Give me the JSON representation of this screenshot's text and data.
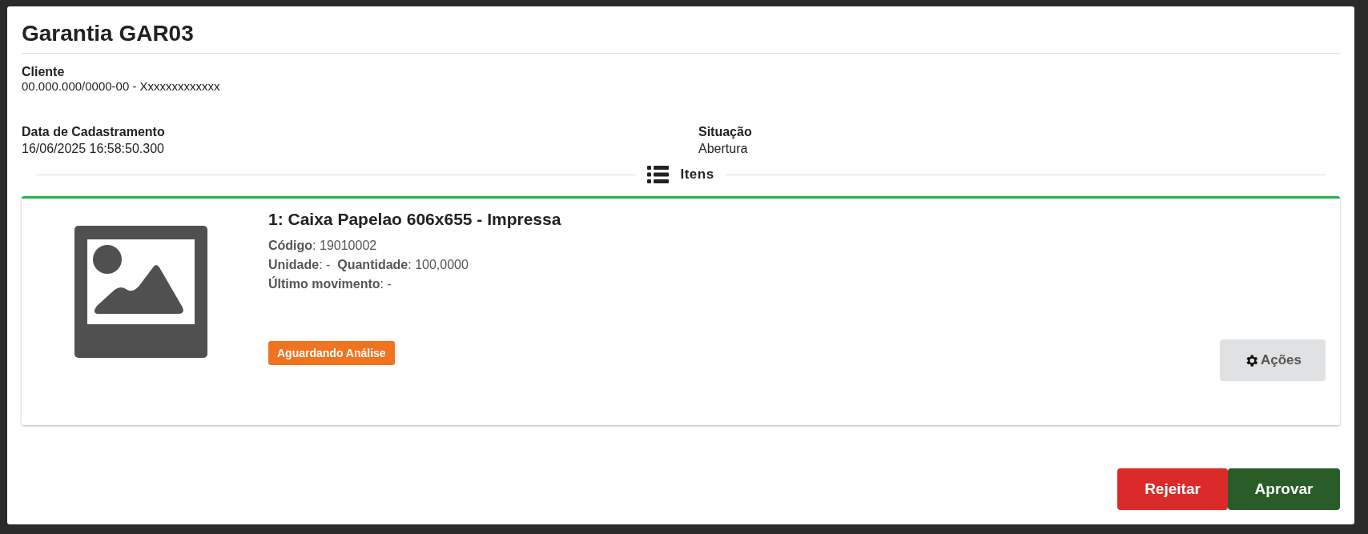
{
  "title": "Garantia GAR03",
  "client": {
    "label": "Cliente",
    "value": "00.000.000/0000-00 - Xxxxxxxxxxxxx"
  },
  "fields": [
    {
      "label": "Data de Cadastramento",
      "value": "16/06/2025 16:58:50.300"
    },
    {
      "label": "Situação",
      "value": "Abertura"
    }
  ],
  "section": {
    "label": "Itens"
  },
  "items": [
    {
      "title": "1: Caixa Papelao 606x655 - Impressa",
      "lines": [
        "**Código**: 19010002",
        "**Unidade**: -  **Quantidade**: 100,0000",
        "**Último movimento**: -"
      ],
      "status": {
        "label": "Aguardando Análise",
        "color": "#f07320"
      },
      "action": {
        "label": "Ações"
      }
    }
  ],
  "buttons": [
    {
      "label": "Rejeitar",
      "kind": "danger"
    },
    {
      "label": "Aprovar",
      "kind": "success"
    }
  ]
}
